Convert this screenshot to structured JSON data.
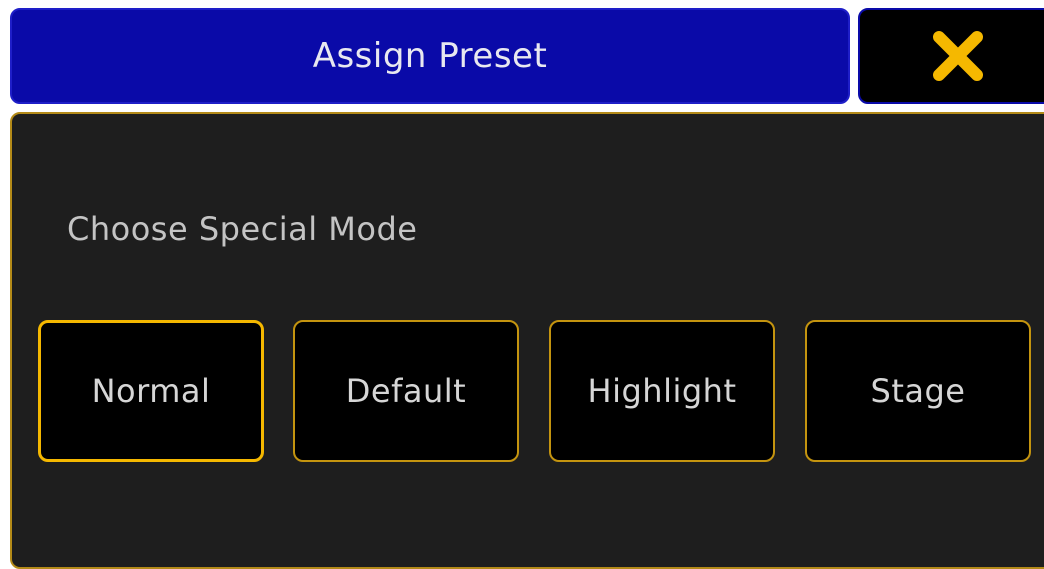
{
  "dialog": {
    "title": "Assign Preset",
    "close_icon": "close-x-icon",
    "prompt": "Choose Special Mode",
    "modes": [
      {
        "label": "Normal",
        "selected": true
      },
      {
        "label": "Default",
        "selected": false
      },
      {
        "label": "Highlight",
        "selected": false
      },
      {
        "label": "Stage",
        "selected": false
      }
    ]
  },
  "colors": {
    "title_bg": "#0a0aa8",
    "panel_bg": "#1e1e1e",
    "accent": "#f5b800",
    "close_icon": "#f5b800"
  }
}
